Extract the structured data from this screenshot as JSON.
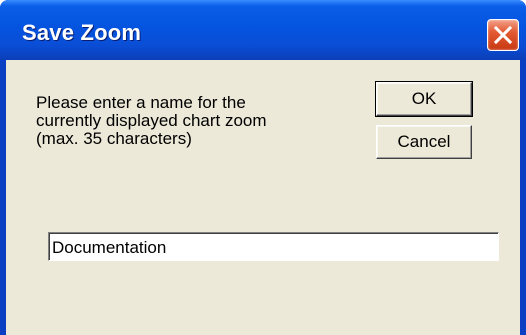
{
  "window": {
    "title": "Save Zoom"
  },
  "message": {
    "lines": [
      "Please enter a name for the",
      "currently displayed chart zoom",
      "(max. 35 characters)"
    ]
  },
  "buttons": {
    "ok_label": "OK",
    "cancel_label": "Cancel"
  },
  "name_field": {
    "value": "Documentation"
  },
  "icons": {
    "close": "close-icon"
  },
  "colors": {
    "title_bar": "#0454e0",
    "client_background": "#ece9d8",
    "close_button": "#e35a33"
  }
}
